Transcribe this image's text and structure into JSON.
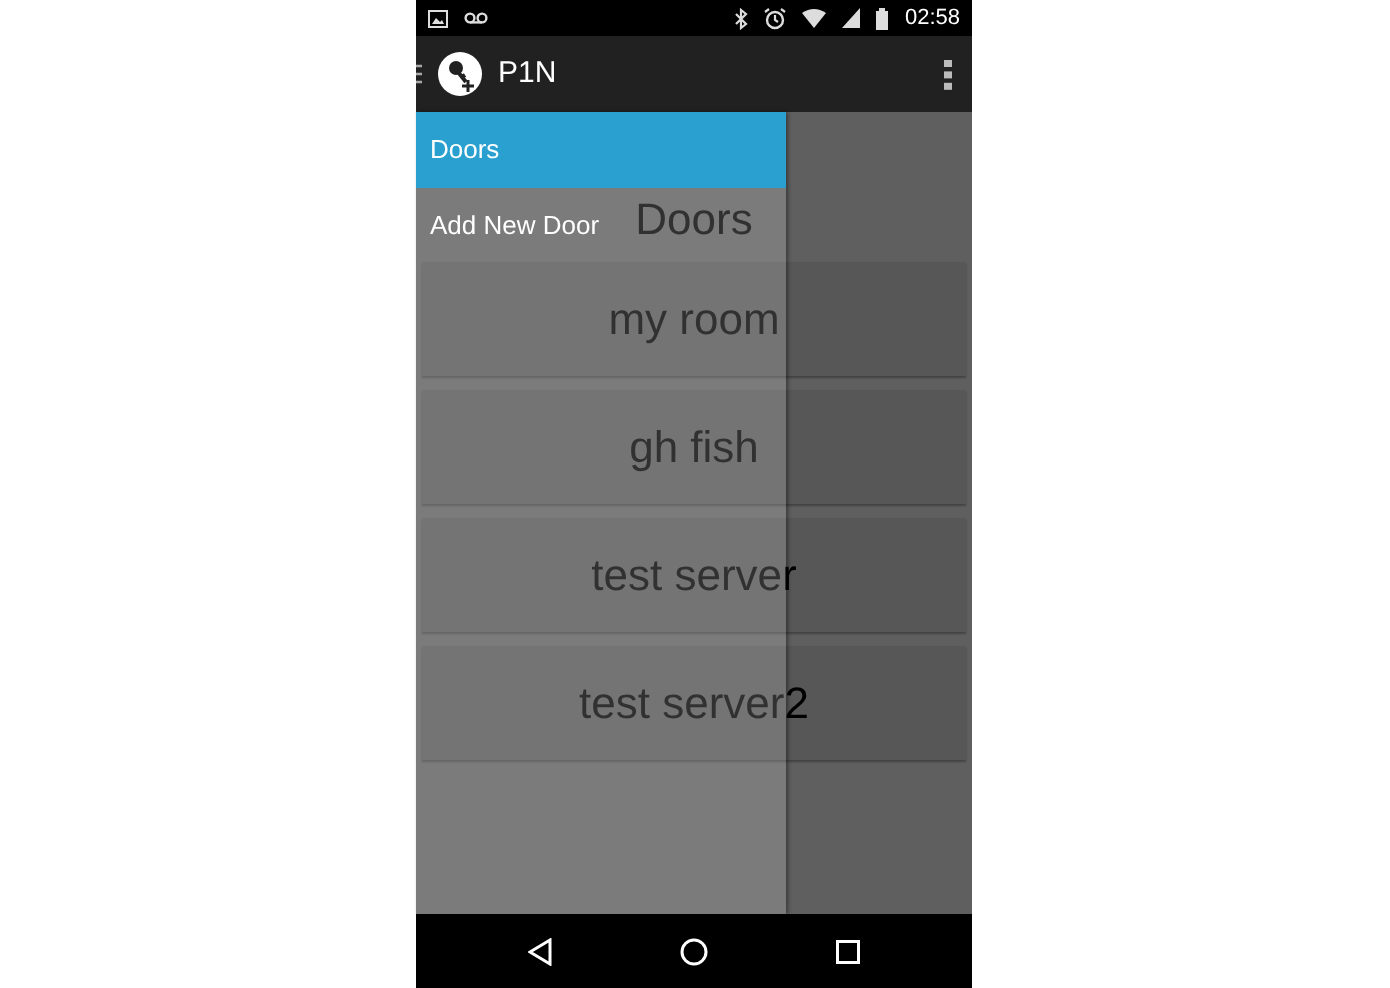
{
  "status_bar": {
    "time": "02:58"
  },
  "app_bar": {
    "title": "P1N"
  },
  "drawer": {
    "items": [
      {
        "label": "Doors",
        "selected": true
      },
      {
        "label": "Add New Door",
        "selected": false
      }
    ]
  },
  "content": {
    "title": "Doors",
    "doors": [
      {
        "name": "my room"
      },
      {
        "name": "gh fish"
      },
      {
        "name": "test server"
      },
      {
        "name": "test server2"
      }
    ]
  }
}
